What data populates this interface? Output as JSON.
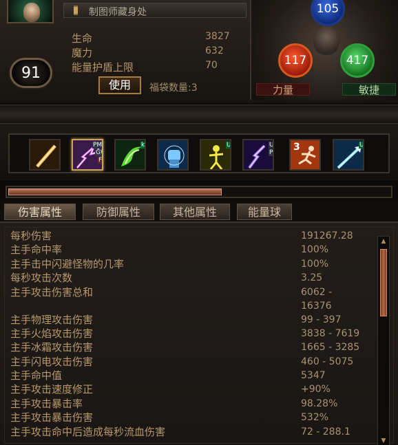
{
  "character": {
    "name": "制图师藏身处",
    "level": "91",
    "stats": [
      {
        "label": "生命",
        "value": "3827"
      },
      {
        "label": "魔力",
        "value": "632"
      },
      {
        "label": "能量护盾上限",
        "value": "70"
      }
    ],
    "use_button_label": "使用",
    "bag_count_label": "福袋数量:3"
  },
  "attributes": {
    "intelligence_value": "105",
    "strength_value": "117",
    "dexterity_value": "417",
    "strength_label": "力量",
    "dexterity_label": "敏捷",
    "colors": {
      "intelligence": "#2f5fd0",
      "strength": "#d7591d",
      "dexterity": "#2fa03b"
    }
  },
  "skills": [
    {
      "icon": "sword-strike-icon",
      "tags": [],
      "selected": false
    },
    {
      "icon": "lightning-blade-icon",
      "tags": [
        "PM",
        "GW",
        "F"
      ],
      "selected": true
    },
    {
      "icon": "green-whirl-icon",
      "tags": [
        "k"
      ],
      "selected": false
    },
    {
      "icon": "fist-icon",
      "tags": [],
      "selected": false
    },
    {
      "icon": "warcry-icon",
      "tags": [
        "U"
      ],
      "selected": false
    },
    {
      "icon": "purple-strike-icon",
      "tags": [
        "U",
        "P"
      ],
      "selected": false
    },
    {
      "icon": "sprint-icon",
      "tags": [
        "3"
      ],
      "selected": false
    },
    {
      "icon": "ice-arrow-icon",
      "tags": [
        "U"
      ],
      "selected": false
    }
  ],
  "experience_progress": 0.56,
  "tabs": [
    {
      "label": "伤害属性",
      "active": true
    },
    {
      "label": "防御属性",
      "active": false
    },
    {
      "label": "其他属性",
      "active": false
    },
    {
      "label": "能量球",
      "active": false
    }
  ],
  "damage_stats": [
    {
      "label": "每秒伤害",
      "value": "191267.28"
    },
    {
      "label": "主手命中率",
      "value": "100%"
    },
    {
      "label": "主手击中闪避怪物的几率",
      "value": "100%"
    },
    {
      "label": "每秒攻击次数",
      "value": "3.25"
    },
    {
      "label": "主手攻击伤害总和",
      "value": "6062 -",
      "value2": "16376"
    },
    {
      "label": "主手物理攻击伤害",
      "value": "99 - 397"
    },
    {
      "label": "主手火焰攻击伤害",
      "value": "3838 - 7619"
    },
    {
      "label": "主手冰霜攻击伤害",
      "value": "1665 - 3285"
    },
    {
      "label": "主手闪电攻击伤害",
      "value": "460 - 5075"
    },
    {
      "label": "主手命中值",
      "value": "5347"
    },
    {
      "label": "主手攻击速度修正",
      "value": "+90%"
    },
    {
      "label": "主手攻击暴击率",
      "value": "98.28%"
    },
    {
      "label": "主手攻击暴击伤害",
      "value": "532%"
    },
    {
      "label": "主手攻击命中后造成每秒流血伤害",
      "value": "72 - 288.1"
    }
  ]
}
